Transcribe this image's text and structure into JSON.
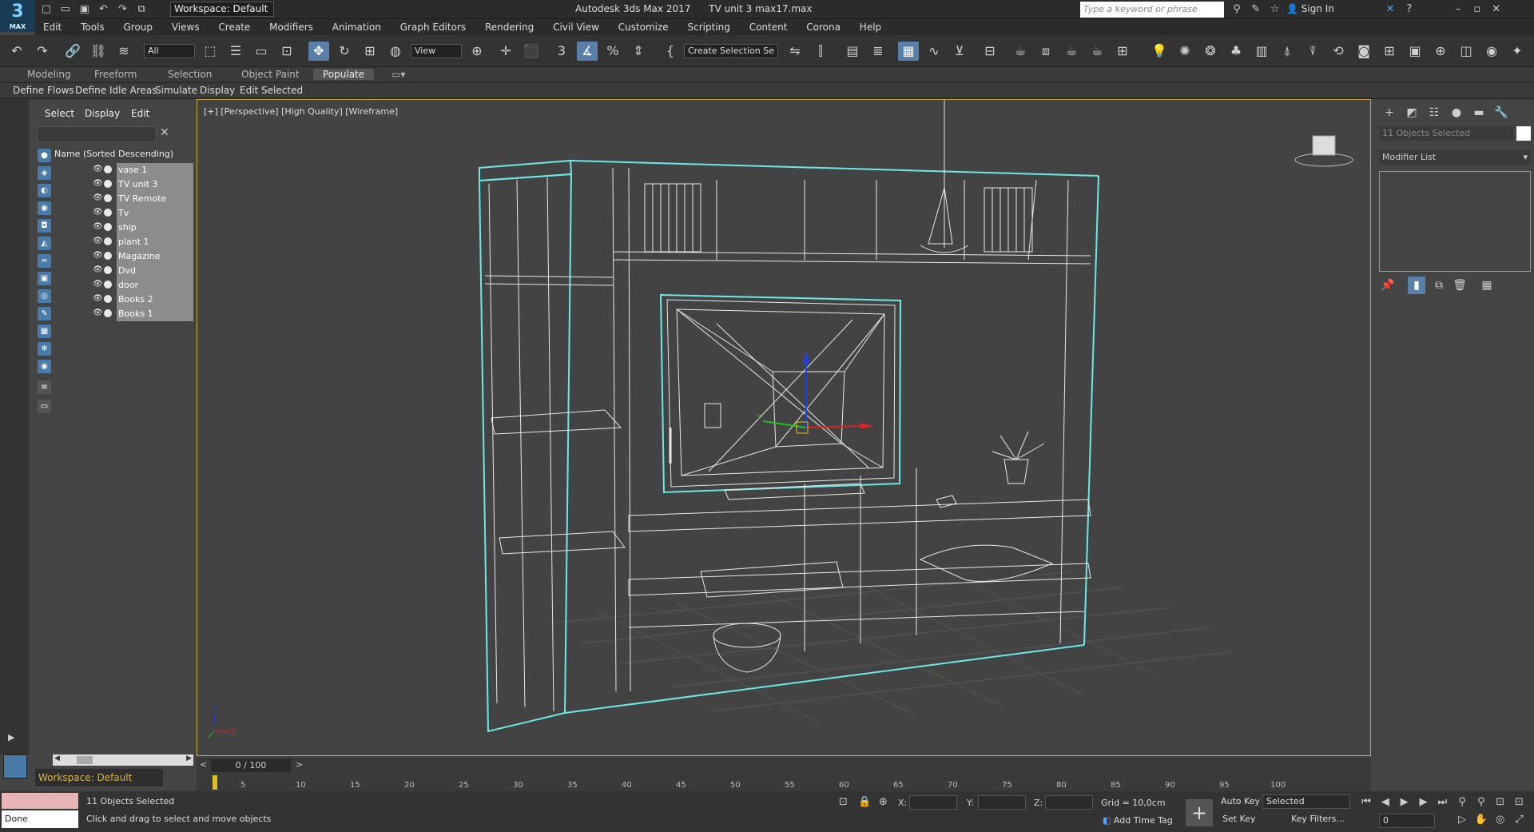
{
  "app": {
    "title": "Autodesk 3ds Max 2017",
    "file": "TV unit 3 max17.max",
    "logo": "3",
    "logo_sub": "MAX",
    "workspace": "Workspace: Default",
    "search_placeholder": "Type a keyword or phrase",
    "sign_in": "Sign In"
  },
  "menu": [
    "Edit",
    "Tools",
    "Group",
    "Views",
    "Create",
    "Modifiers",
    "Animation",
    "Graph Editors",
    "Rendering",
    "Civil View",
    "Customize",
    "Scripting",
    "Content",
    "Corona",
    "Help"
  ],
  "toolbar": {
    "filter": "All",
    "coord": "View",
    "selection_set": "Create Selection Se"
  },
  "ribbon": {
    "tabs": [
      "Modeling",
      "Freeform",
      "Selection",
      "Object Paint",
      "Populate"
    ],
    "active": "Populate",
    "subtabs": [
      "Define Flows",
      "Define Idle Areas",
      "Simulate",
      "Display",
      "Edit Selected"
    ]
  },
  "explorer": {
    "tabs": [
      "Select",
      "Display",
      "Edit"
    ],
    "header": "Name (Sorted Descending)",
    "items": [
      "vase 1",
      "TV unit 3",
      "TV Remote",
      "Tv",
      "ship",
      "plant 1",
      "Magazine",
      "Dvd",
      "door",
      "Books 2",
      "Books 1"
    ]
  },
  "viewport": {
    "label": "[+] [Perspective] [High Quality] [Wireframe]",
    "gizmo_x": "X",
    "gizmo_y": "Y",
    "gizmo_z": "Z"
  },
  "command_panel": {
    "selected": "11 Objects Selected",
    "modifier_list": "Modifier List"
  },
  "timeline": {
    "frame": "0 / 100",
    "ticks": [
      "5",
      "10",
      "15",
      "20",
      "25",
      "30",
      "35",
      "40",
      "45",
      "50",
      "55",
      "60",
      "65",
      "70",
      "75",
      "80",
      "85",
      "90",
      "95",
      "100"
    ]
  },
  "status": {
    "workspace": "Workspace: Default",
    "done": "Done",
    "selected": "11 Objects Selected",
    "prompt": "Click and drag to select and move objects",
    "x_label": "X:",
    "y_label": "Y:",
    "z_label": "Z:",
    "grid": "Grid = 10,0cm",
    "add_time_tag": "Add Time Tag",
    "auto_key": "Auto Key",
    "set_key": "Set Key",
    "selected_dd": "Selected",
    "key_filters": "Key Filters...",
    "frame_field": "0"
  },
  "colors": {
    "selection_cyan": "#6fe7e7",
    "wire_white": "#e8e8e8",
    "viewport_border": "#c7a250",
    "axis_x": "#e02020",
    "axis_y": "#20c020",
    "axis_z": "#2040e0"
  }
}
